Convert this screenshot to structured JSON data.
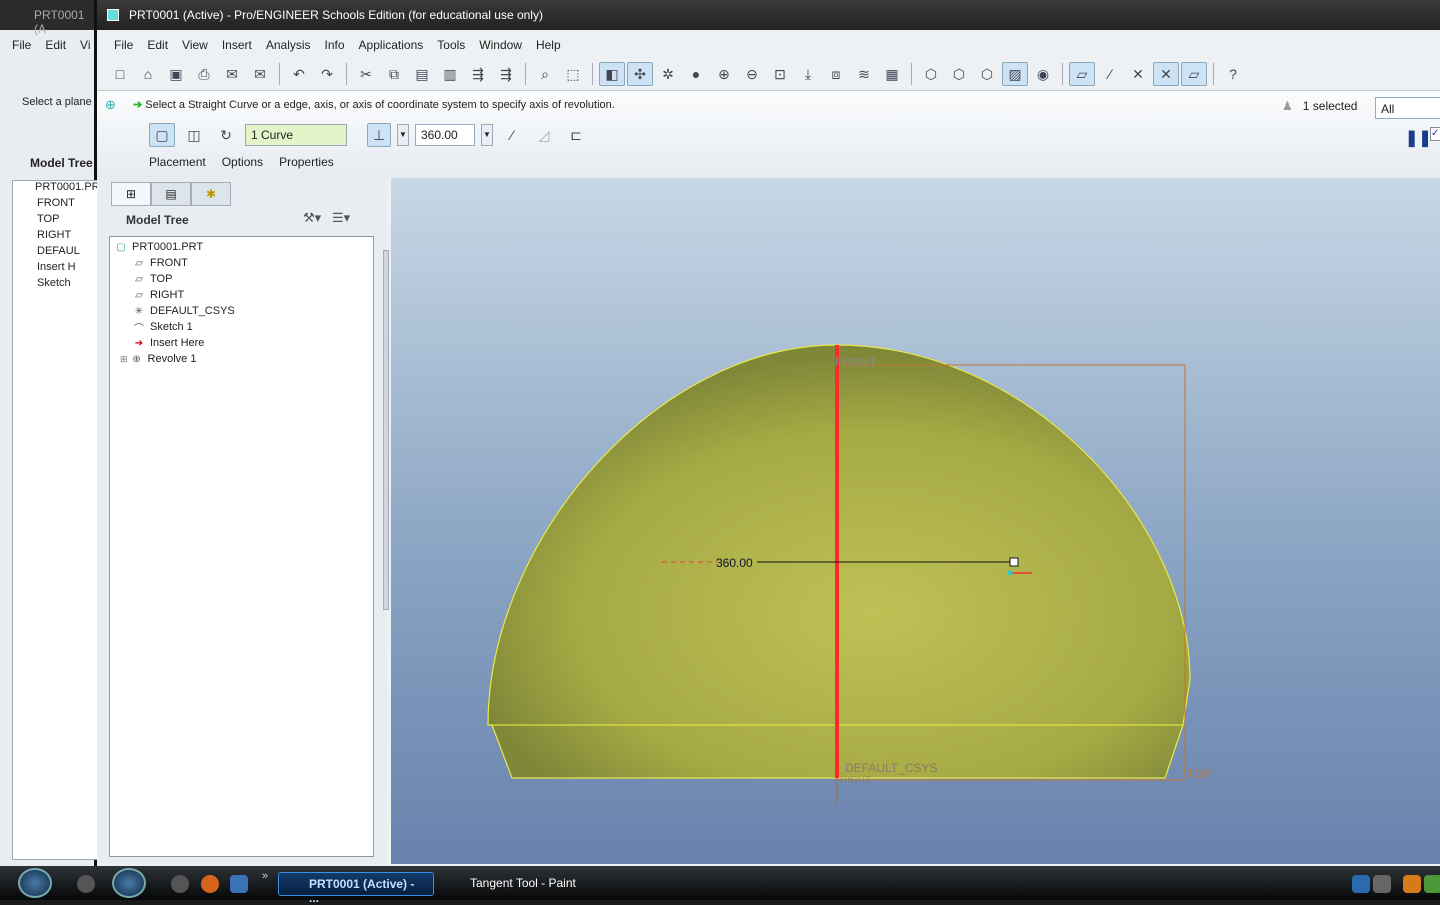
{
  "background_window": {
    "title": "PRT0001 (A",
    "menu": [
      "File",
      "Edit",
      "Vi"
    ],
    "prompt": "Select a plane",
    "tree_header": "Model Tree",
    "tree": [
      "PRT0001.PR",
      "FRONT",
      "TOP",
      "RIGHT",
      "DEFAUL",
      "Insert H",
      "Sketch"
    ]
  },
  "window": {
    "title": "PRT0001 (Active) - Pro/ENGINEER Schools Edition (for educational use only)"
  },
  "menu": [
    "File",
    "Edit",
    "View",
    "Insert",
    "Analysis",
    "Info",
    "Applications",
    "Tools",
    "Window",
    "Help"
  ],
  "toolbar_icons": [
    "new",
    "open",
    "save",
    "print",
    "email",
    "email-link",
    "undo",
    "redo",
    "cut",
    "copy",
    "paste",
    "paste-special",
    "regenerate",
    "regenerate-manager",
    "find",
    "select-box",
    "datum-display",
    "point-display",
    "spin-center",
    "shading",
    "zoom-in",
    "zoom-out",
    "refit",
    "reorient",
    "saved-views",
    "layers",
    "view-manager",
    "wireframe",
    "hidden-line",
    "no-hidden",
    "shaded",
    "display-style",
    "plane-display",
    "axis-display",
    "point-display-2",
    "csys-display",
    "annotation-display",
    "context-help"
  ],
  "dashboard": {
    "prompt": "Select a  Straight Curve or a edge, axis, or axis of coordinate system to specify axis of revolution.",
    "axis_collector": "1 Curve",
    "angle": "360.00",
    "tabs": [
      "Placement",
      "Options",
      "Properties"
    ],
    "selected": "1 selected",
    "filter": "All"
  },
  "model_tree": {
    "header": "Model Tree",
    "items": [
      {
        "label": "PRT0001.PRT",
        "icon": "part-icon"
      },
      {
        "label": "FRONT",
        "icon": "datum-plane-icon"
      },
      {
        "label": "TOP",
        "icon": "datum-plane-icon"
      },
      {
        "label": "RIGHT",
        "icon": "datum-plane-icon"
      },
      {
        "label": "DEFAULT_CSYS",
        "icon": "csys-icon"
      },
      {
        "label": "Sketch 1",
        "icon": "sketch-icon"
      },
      {
        "label": "Insert Here",
        "icon": "insert-arrow-icon"
      },
      {
        "label": "Revolve 1",
        "icon": "revolve-icon"
      }
    ]
  },
  "graphics": {
    "dimension": "360.00",
    "labels": {
      "front": "FRONT",
      "csys": "DEFAULT_CSYS",
      "top": "TOP",
      "right": "RIGHT"
    },
    "colors": {
      "solid": "#b8bb4c",
      "axis": "#ff2a2a",
      "datum": "#c0782a"
    }
  },
  "taskbar": {
    "buttons": [
      "PRT0001 (Active) - ...",
      "Tangent Tool - Paint"
    ]
  }
}
